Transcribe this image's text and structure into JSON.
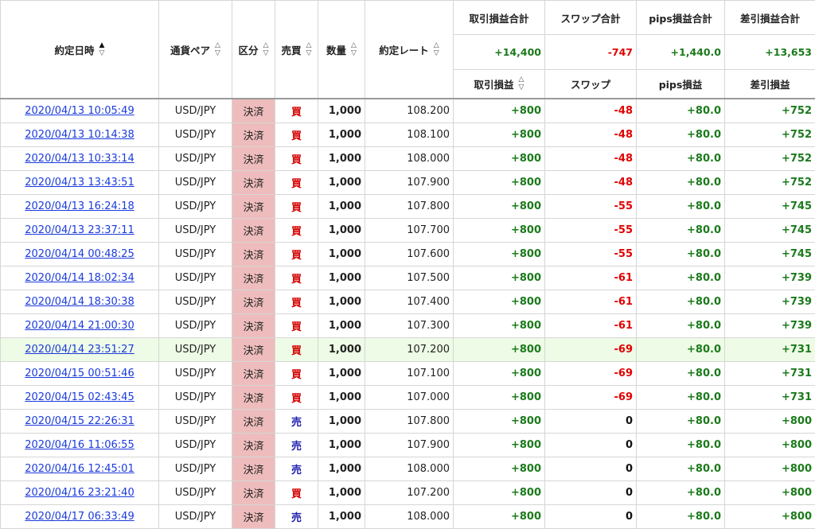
{
  "headers": {
    "date": "約定日時",
    "pair": "通貨ペア",
    "type": "区分",
    "side": "売買",
    "qty": "数量",
    "rate": "約定レート",
    "pl_total": "取引損益合計",
    "swap_total": "スワップ合計",
    "pips_total": "pips損益合計",
    "net_total": "差引損益合計",
    "pl": "取引損益",
    "swap": "スワップ",
    "pips": "pips損益",
    "net": "差引損益"
  },
  "sort_icons": {
    "asc": "▲",
    "desc": "▽",
    "asc_off": "△"
  },
  "totals": {
    "pl": "+14,400",
    "swap": "-747",
    "pips": "+1,440.0",
    "net": "+13,653"
  },
  "rows": [
    {
      "date": "2020/04/13 10:05:49",
      "pair": "USD/JPY",
      "type": "決済",
      "side": "買",
      "qty": "1,000",
      "rate": "108.200",
      "pl": "+800",
      "swap": "-48",
      "pips": "+80.0",
      "net": "+752"
    },
    {
      "date": "2020/04/13 10:14:38",
      "pair": "USD/JPY",
      "type": "決済",
      "side": "買",
      "qty": "1,000",
      "rate": "108.100",
      "pl": "+800",
      "swap": "-48",
      "pips": "+80.0",
      "net": "+752"
    },
    {
      "date": "2020/04/13 10:33:14",
      "pair": "USD/JPY",
      "type": "決済",
      "side": "買",
      "qty": "1,000",
      "rate": "108.000",
      "pl": "+800",
      "swap": "-48",
      "pips": "+80.0",
      "net": "+752"
    },
    {
      "date": "2020/04/13 13:43:51",
      "pair": "USD/JPY",
      "type": "決済",
      "side": "買",
      "qty": "1,000",
      "rate": "107.900",
      "pl": "+800",
      "swap": "-48",
      "pips": "+80.0",
      "net": "+752"
    },
    {
      "date": "2020/04/13 16:24:18",
      "pair": "USD/JPY",
      "type": "決済",
      "side": "買",
      "qty": "1,000",
      "rate": "107.800",
      "pl": "+800",
      "swap": "-55",
      "pips": "+80.0",
      "net": "+745"
    },
    {
      "date": "2020/04/13 23:37:11",
      "pair": "USD/JPY",
      "type": "決済",
      "side": "買",
      "qty": "1,000",
      "rate": "107.700",
      "pl": "+800",
      "swap": "-55",
      "pips": "+80.0",
      "net": "+745"
    },
    {
      "date": "2020/04/14 00:48:25",
      "pair": "USD/JPY",
      "type": "決済",
      "side": "買",
      "qty": "1,000",
      "rate": "107.600",
      "pl": "+800",
      "swap": "-55",
      "pips": "+80.0",
      "net": "+745"
    },
    {
      "date": "2020/04/14 18:02:34",
      "pair": "USD/JPY",
      "type": "決済",
      "side": "買",
      "qty": "1,000",
      "rate": "107.500",
      "pl": "+800",
      "swap": "-61",
      "pips": "+80.0",
      "net": "+739"
    },
    {
      "date": "2020/04/14 18:30:38",
      "pair": "USD/JPY",
      "type": "決済",
      "side": "買",
      "qty": "1,000",
      "rate": "107.400",
      "pl": "+800",
      "swap": "-61",
      "pips": "+80.0",
      "net": "+739"
    },
    {
      "date": "2020/04/14 21:00:30",
      "pair": "USD/JPY",
      "type": "決済",
      "side": "買",
      "qty": "1,000",
      "rate": "107.300",
      "pl": "+800",
      "swap": "-61",
      "pips": "+80.0",
      "net": "+739"
    },
    {
      "date": "2020/04/14 23:51:27",
      "pair": "USD/JPY",
      "type": "決済",
      "side": "買",
      "qty": "1,000",
      "rate": "107.200",
      "pl": "+800",
      "swap": "-69",
      "pips": "+80.0",
      "net": "+731",
      "highlight": true
    },
    {
      "date": "2020/04/15 00:51:46",
      "pair": "USD/JPY",
      "type": "決済",
      "side": "買",
      "qty": "1,000",
      "rate": "107.100",
      "pl": "+800",
      "swap": "-69",
      "pips": "+80.0",
      "net": "+731"
    },
    {
      "date": "2020/04/15 02:43:45",
      "pair": "USD/JPY",
      "type": "決済",
      "side": "買",
      "qty": "1,000",
      "rate": "107.000",
      "pl": "+800",
      "swap": "-69",
      "pips": "+80.0",
      "net": "+731"
    },
    {
      "date": "2020/04/15 22:26:31",
      "pair": "USD/JPY",
      "type": "決済",
      "side": "売",
      "qty": "1,000",
      "rate": "107.800",
      "pl": "+800",
      "swap": "0",
      "pips": "+80.0",
      "net": "+800"
    },
    {
      "date": "2020/04/16 11:06:55",
      "pair": "USD/JPY",
      "type": "決済",
      "side": "売",
      "qty": "1,000",
      "rate": "107.900",
      "pl": "+800",
      "swap": "0",
      "pips": "+80.0",
      "net": "+800"
    },
    {
      "date": "2020/04/16 12:45:01",
      "pair": "USD/JPY",
      "type": "決済",
      "side": "売",
      "qty": "1,000",
      "rate": "108.000",
      "pl": "+800",
      "swap": "0",
      "pips": "+80.0",
      "net": "+800"
    },
    {
      "date": "2020/04/16 23:21:40",
      "pair": "USD/JPY",
      "type": "決済",
      "side": "買",
      "qty": "1,000",
      "rate": "107.200",
      "pl": "+800",
      "swap": "0",
      "pips": "+80.0",
      "net": "+800"
    },
    {
      "date": "2020/04/17 06:33:49",
      "pair": "USD/JPY",
      "type": "決済",
      "side": "売",
      "qty": "1,000",
      "rate": "108.000",
      "pl": "+800",
      "swap": "0",
      "pips": "+80.0",
      "net": "+800"
    }
  ],
  "colors": {
    "positive": "#1b7a1b",
    "negative": "#e00000",
    "buy": "#d40000",
    "sell": "#2020b0",
    "type_bg": "#eebcbc",
    "link": "#1a3bdc",
    "highlight_row": "#eefbe6"
  }
}
